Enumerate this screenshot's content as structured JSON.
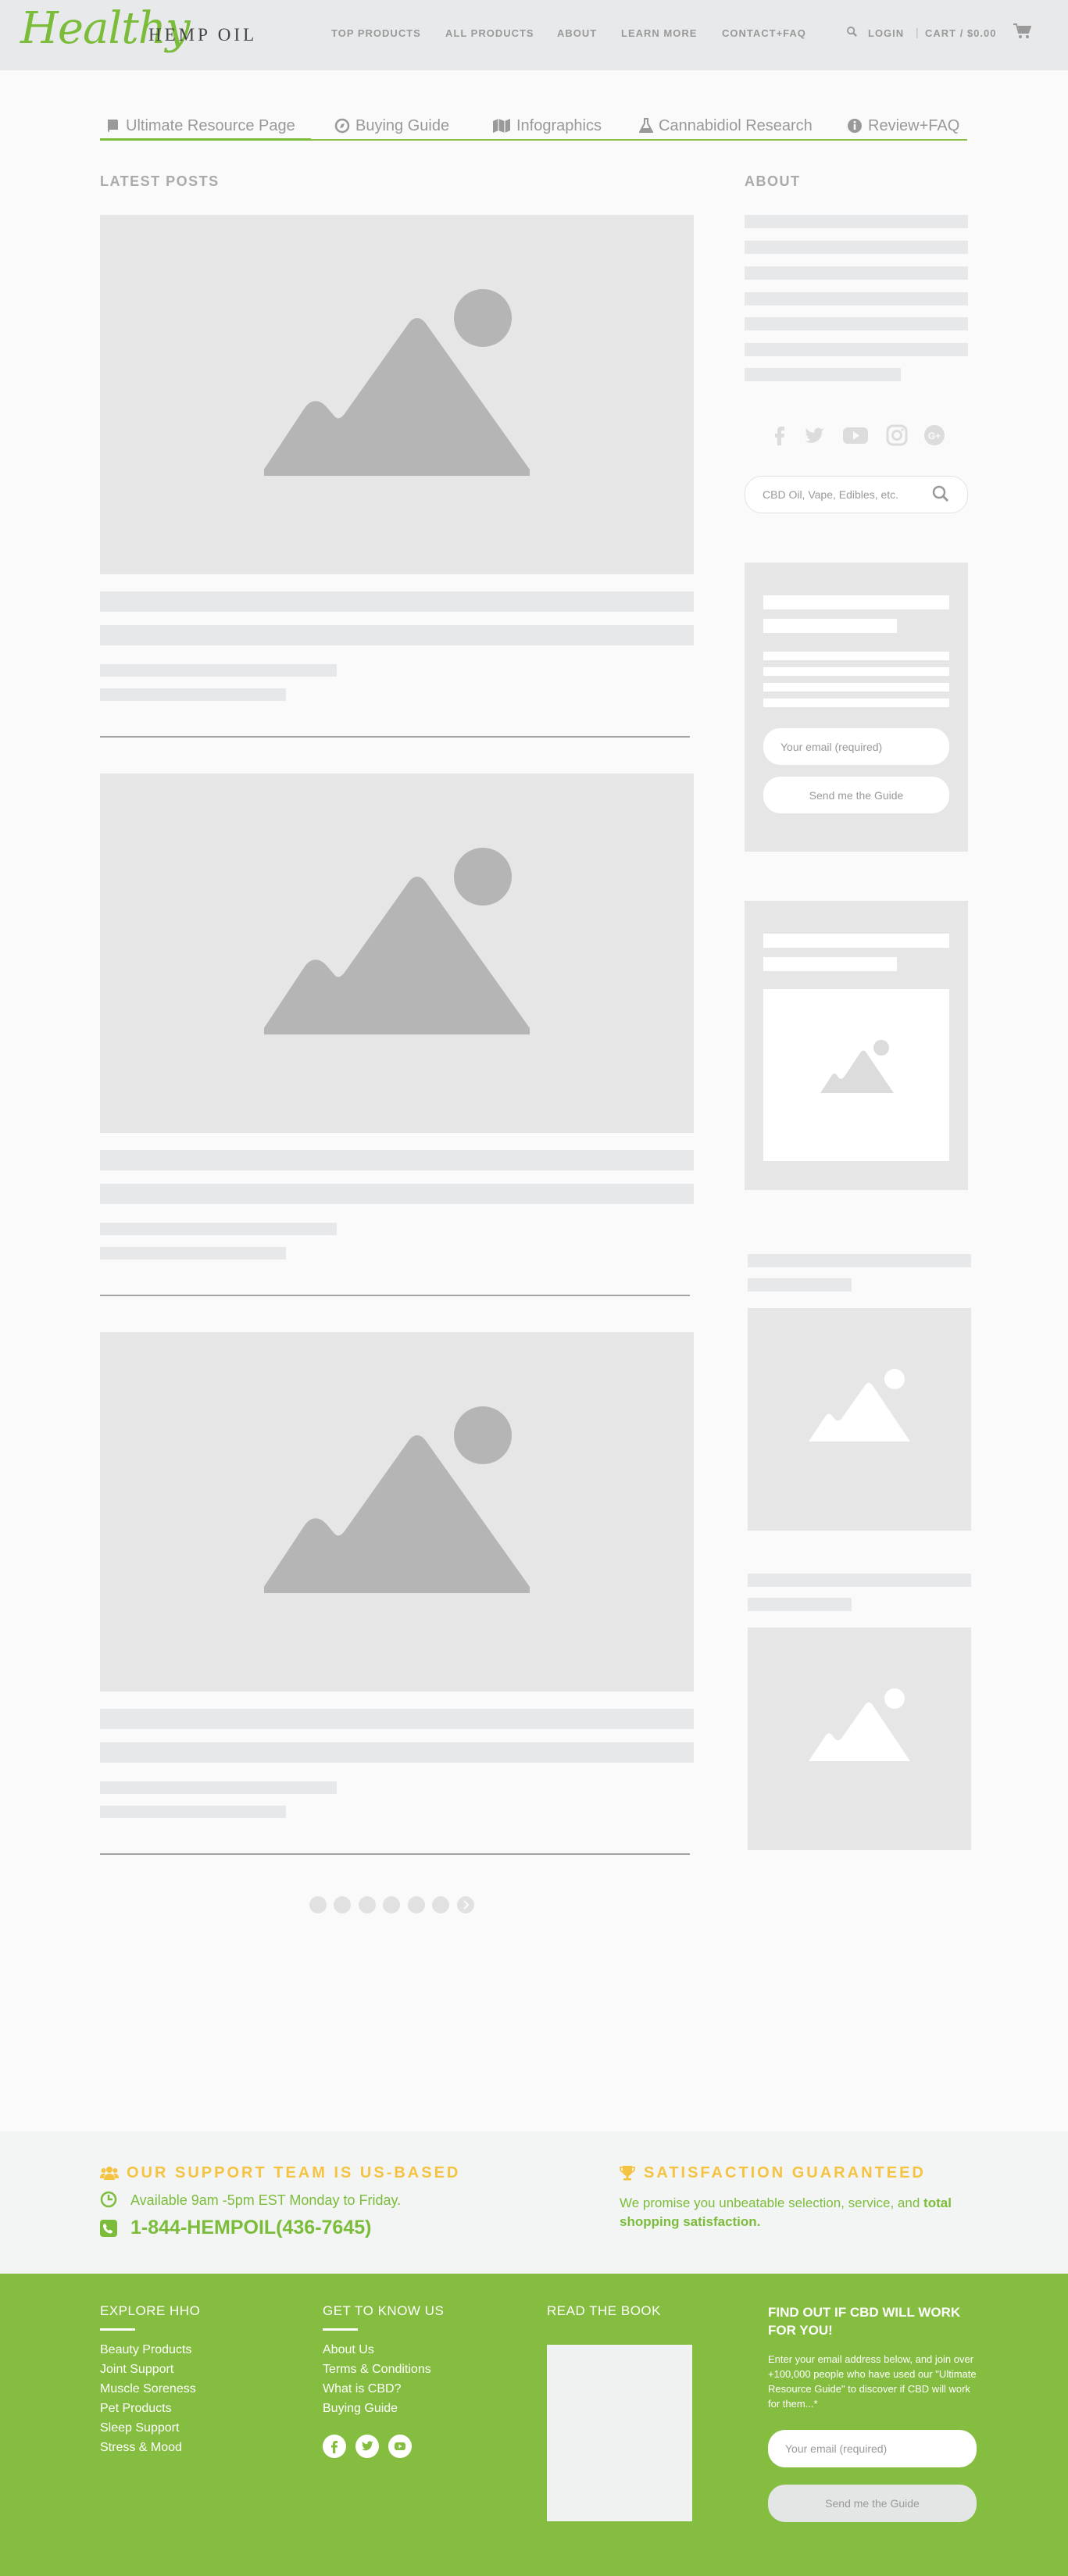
{
  "header": {
    "logo_script": "Healthy",
    "logo_text": "HEMP OIL",
    "nav": [
      "TOP PRODUCTS",
      "ALL PRODUCTS",
      "ABOUT",
      "LEARN MORE",
      "CONTACT+FAQ"
    ],
    "login": "LOGIN",
    "cart": "CART / $0.00"
  },
  "tabs": [
    {
      "label": "Ultimate Resource Page",
      "icon": "book-icon"
    },
    {
      "label": "Buying Guide",
      "icon": "compass-icon"
    },
    {
      "label": "Infographics",
      "icon": "map-icon"
    },
    {
      "label": "Cannabidiol Research",
      "icon": "flask-icon"
    },
    {
      "label": "Review+FAQ",
      "icon": "info-icon"
    }
  ],
  "main": {
    "latest_posts_title": "LATEST POSTS"
  },
  "sidebar": {
    "about_title": "ABOUT",
    "search_placeholder": "CBD Oil, Vape, Edibles, etc.",
    "guide_email_placeholder": "Your email (required)",
    "guide_button": "Send me the Guide"
  },
  "support": {
    "team_title": "OUR SUPPORT TEAM IS US-BASED",
    "hours": "Available 9am -5pm EST Monday to Friday.",
    "phone": "1-844-HEMPOIL(436-7645)",
    "guarantee_title": "SATISFACTION GUARANTEED",
    "guarantee_text_1": "We promise you unbeatable selection, service, and ",
    "guarantee_bold_1": "total",
    "guarantee_bold_2": "shopping satisfaction",
    "guarantee_end": "."
  },
  "footer": {
    "explore_title": "EXPLORE HHO",
    "explore_links": [
      "Beauty Products",
      "Joint Support",
      "Muscle Soreness",
      "Pet Products",
      "Sleep Support",
      "Stress & Mood"
    ],
    "know_title": "GET TO KNOW US",
    "know_links": [
      "About Us",
      "Terms & Conditions",
      "What is CBD?",
      "Buying Guide"
    ],
    "book_title": "READ THE BOOK",
    "cbd_title_1": "FIND OUT IF CBD WILL WORK",
    "cbd_title_2": "FOR YOU!",
    "cbd_text": "Enter your email address below, and join over +100,000 people who have used our \"Ultimate Resource Guide\" to discover if CBD will work for them...*",
    "email_placeholder": "Your email (required)",
    "button": "Send me the Guide"
  },
  "colors": {
    "brand_green": "#7bbd3a",
    "footer_green": "#84bd3f",
    "accent_yellow": "#f5c342"
  }
}
